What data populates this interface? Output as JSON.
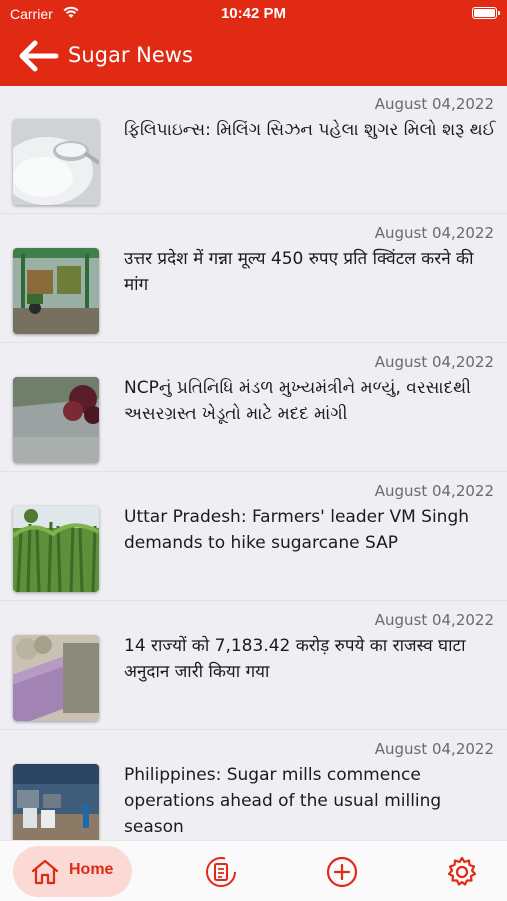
{
  "status_bar": {
    "carrier": "Carrier",
    "time": "10:42 PM"
  },
  "app_bar": {
    "title": "Sugar News"
  },
  "news": [
    {
      "date": "August 04,2022",
      "title": "ફિલિપાઇન્સ: મિલિંગ સિઝન પહેલા શુગર મિલો શરૂ થઈ",
      "image": "sugar-spoon"
    },
    {
      "date": "August 04,2022",
      "title": "उत्तर प्रदेश में गन्ना मूल्य 450 रुपए प्रति क्विंटल करने की मांग",
      "image": "sugarcane-tractor"
    },
    {
      "date": "August 04,2022",
      "title": "NCPનું પ્રતિનિધિ મંડળ મુખ્યમંત્રીને મળ્યું, વરસાદથી અસરગ્રસ્ત ખેડૂતો માટે મદદ માંગી",
      "image": "flooded-field"
    },
    {
      "date": "August 04,2022",
      "title": "Uttar Pradesh: Farmers' leader VM Singh demands to hike sugarcane SAP",
      "image": "sugarcane-field"
    },
    {
      "date": "August 04,2022",
      "title": "14 राज्यों को 7,183.42 करोड़ रुपये का राजस्व घाटा अनुदान जारी किया गया",
      "image": "currency-notes"
    },
    {
      "date": "August 04,2022",
      "title": "Philippines: Sugar mills commence operations ahead of the usual milling season",
      "image": "sugar-mill-warehouse"
    }
  ],
  "bottom_nav": {
    "home_label": "Home",
    "icons": [
      "home-icon",
      "news-list-icon",
      "add-icon",
      "settings-icon"
    ]
  },
  "colors": {
    "primary": "#e12a14",
    "home_pill": "#fbd9d4",
    "background": "#efeef3"
  }
}
